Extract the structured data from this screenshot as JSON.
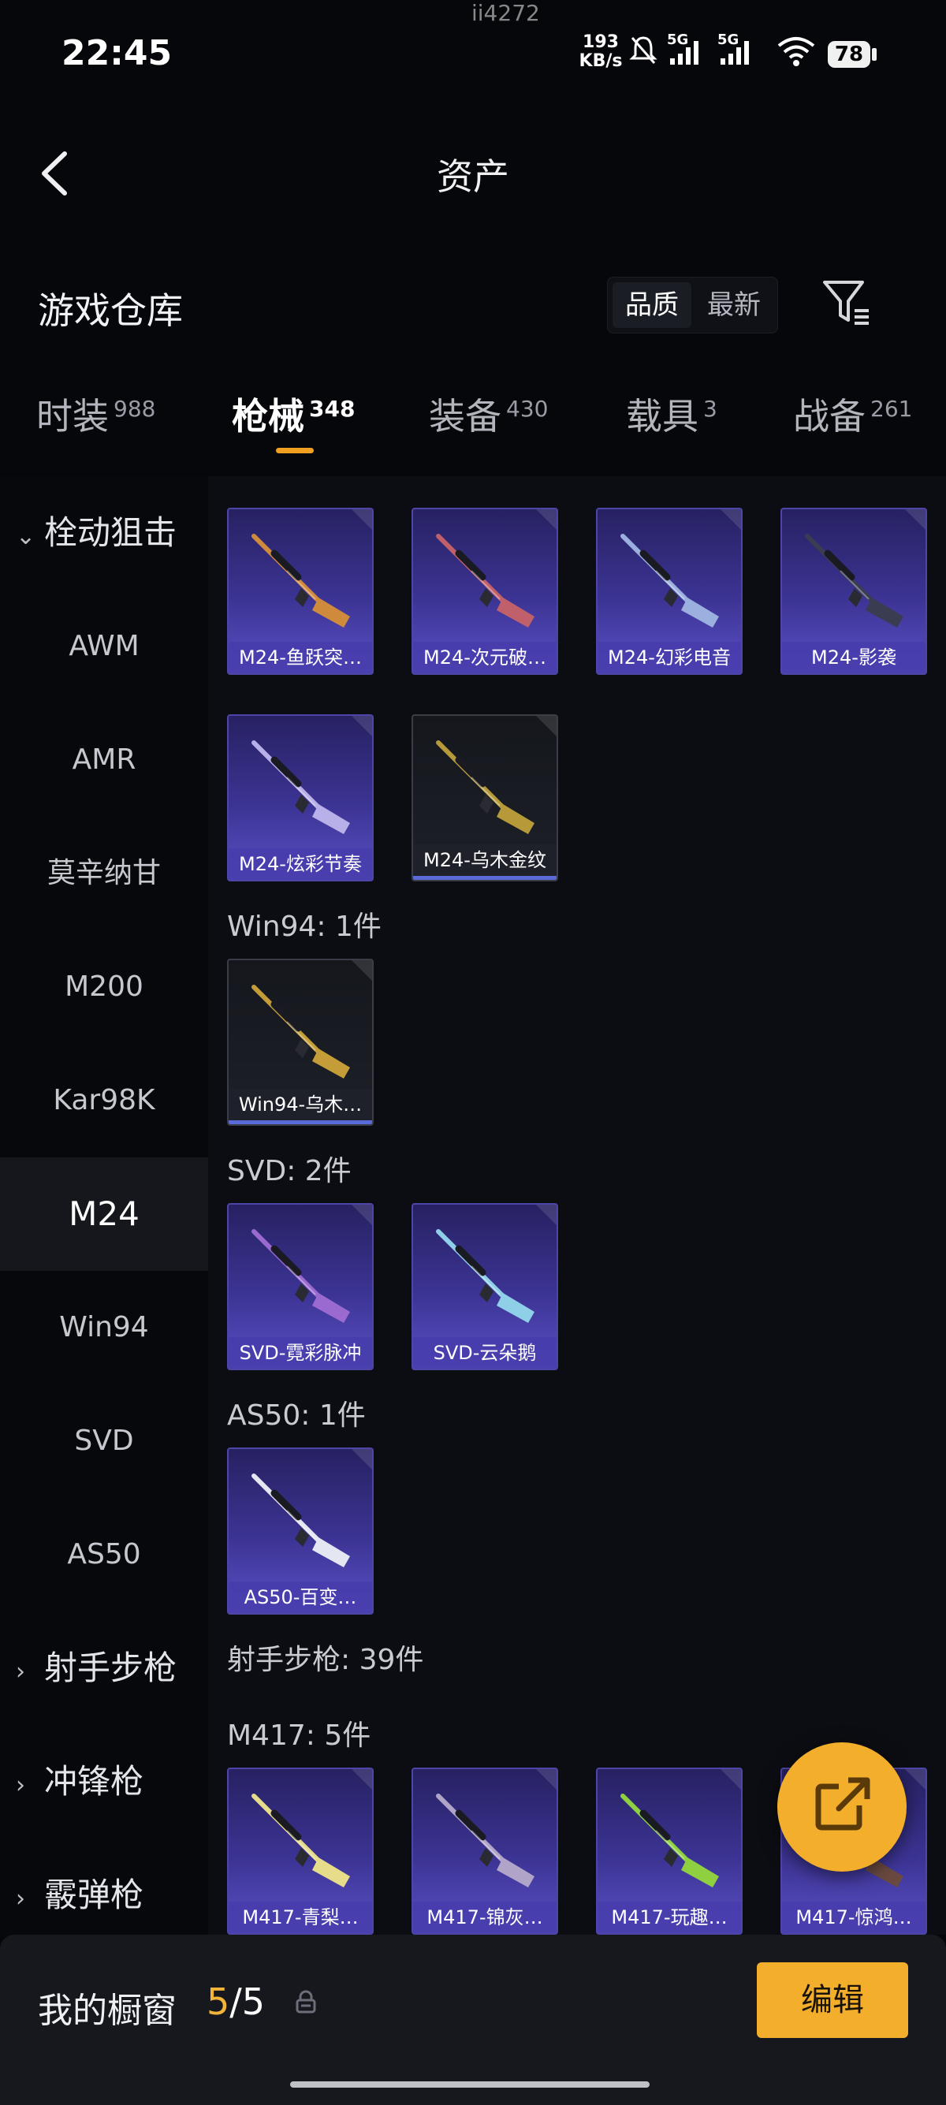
{
  "status_bar": {
    "time": "22:45",
    "net_speed_value": "193",
    "net_speed_unit": "KB/s",
    "signal_label_1": "5G",
    "signal_label_2": "5G",
    "battery": "78",
    "top_notch_text": "ii4272"
  },
  "header": {
    "title": "资产"
  },
  "warehouse": {
    "title": "游戏仓库",
    "sort_options": [
      "品质",
      "最新"
    ],
    "sort_selected": "品质"
  },
  "tabs": [
    {
      "label": "时装",
      "count": "988"
    },
    {
      "label": "枪械",
      "count": "348",
      "active": true
    },
    {
      "label": "装备",
      "count": "430"
    },
    {
      "label": "载具",
      "count": "3"
    },
    {
      "label": "战备",
      "count": "261"
    }
  ],
  "sidebar": {
    "group_bolt_sniper": "栓动狙击",
    "items": [
      "AWM",
      "AMR",
      "莫辛纳甘",
      "M200",
      "Kar98K",
      "M24",
      "Win94",
      "SVD",
      "AS50"
    ],
    "selected": "M24",
    "group_dmr": "射手步枪",
    "group_smg": "冲锋枪",
    "group_shotgun": "霰弹枪"
  },
  "content": {
    "m24_cards": [
      {
        "name": "M24-鱼跃突…",
        "tier": "purple",
        "color": "#d08a3c"
      },
      {
        "name": "M24-次元破…",
        "tier": "purple",
        "color": "#c0606a"
      },
      {
        "name": "M24-幻彩电音",
        "tier": "purple",
        "color": "#9cb0e0"
      },
      {
        "name": "M24-影袭",
        "tier": "purple",
        "color": "#3a3c52"
      },
      {
        "name": "M24-炫彩节奏",
        "tier": "purple",
        "color": "#b8b0e8"
      },
      {
        "name": "M24-乌木金纹",
        "tier": "gray",
        "color": "#b69a3a"
      }
    ],
    "win94_title": "Win94: 1件",
    "win94_cards": [
      {
        "name": "Win94-乌木…",
        "tier": "gray",
        "color": "#c49d38"
      }
    ],
    "svd_title": "SVD: 2件",
    "svd_cards": [
      {
        "name": "SVD-霓彩脉冲",
        "tier": "purple",
        "color": "#9a6ad0"
      },
      {
        "name": "SVD-云朵鹅",
        "tier": "purple",
        "color": "#8fd0e8"
      }
    ],
    "as50_title": "AS50: 1件",
    "as50_cards": [
      {
        "name": "AS50-百变…",
        "tier": "purple",
        "color": "#e4e6f2"
      }
    ],
    "dmr_title": "射手步枪: 39件",
    "m417_title": "M417: 5件",
    "m417_cards": [
      {
        "name": "M417-青梨…",
        "tier": "purple",
        "color": "#e6dc8a"
      },
      {
        "name": "M417-锦灰…",
        "tier": "purple",
        "color": "#b0a4c8"
      },
      {
        "name": "M417-玩趣…",
        "tier": "purple",
        "color": "#8ed040"
      },
      {
        "name": "M417-惊鸿…",
        "tier": "purple",
        "color": "#6a4a40"
      }
    ]
  },
  "bottom_bar": {
    "showcase_label": "我的橱窗",
    "showcase_current": "5",
    "showcase_separator": "/",
    "showcase_total": "5",
    "edit_label": "编辑"
  },
  "colors": {
    "accent": "#f3ae2b",
    "card_purple": "#3c3494",
    "background": "#06070a"
  }
}
